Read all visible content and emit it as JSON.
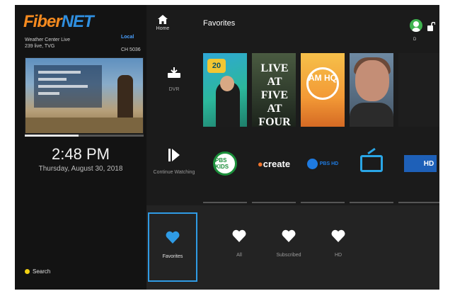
{
  "left_panel": {
    "logo_fiber": "Fiber",
    "logo_net": "NET",
    "channel_name": "Weather Center Live",
    "channel_sub": "239 live, TVG",
    "network_badge": "Local",
    "channel_number": "CH 5036",
    "playback_progress": 0.45,
    "clock": "2:48 PM",
    "date": "Thursday, August 30, 2018",
    "search_hint": "Search"
  },
  "top_bar": {
    "home_label": "Home",
    "page_title": "Favorites",
    "avatar_label": "D"
  },
  "rows": {
    "dvr_label": "DVR",
    "continue_label": "Continue Watching",
    "posters": [
      {
        "badge": "20"
      },
      {
        "title": "LIVE AT FIVE AT FOUR"
      },
      {
        "title": "AM HQ"
      },
      {},
      {}
    ],
    "channels": [
      {
        "name": "PBS KIDS"
      },
      {
        "name": "create"
      },
      {
        "name": "PBS HD"
      },
      {
        "name": "TV"
      },
      {
        "name": "HD"
      }
    ]
  },
  "filters": {
    "favorites": "Favorites",
    "all": "All",
    "subscribed": "Subscribed",
    "hd": "HD",
    "selected": "favorites"
  },
  "colors": {
    "accent": "#2f9be5",
    "logo_orange": "#f58a1f",
    "logo_blue": "#2f8fe0",
    "search_dot": "#f3d213"
  }
}
